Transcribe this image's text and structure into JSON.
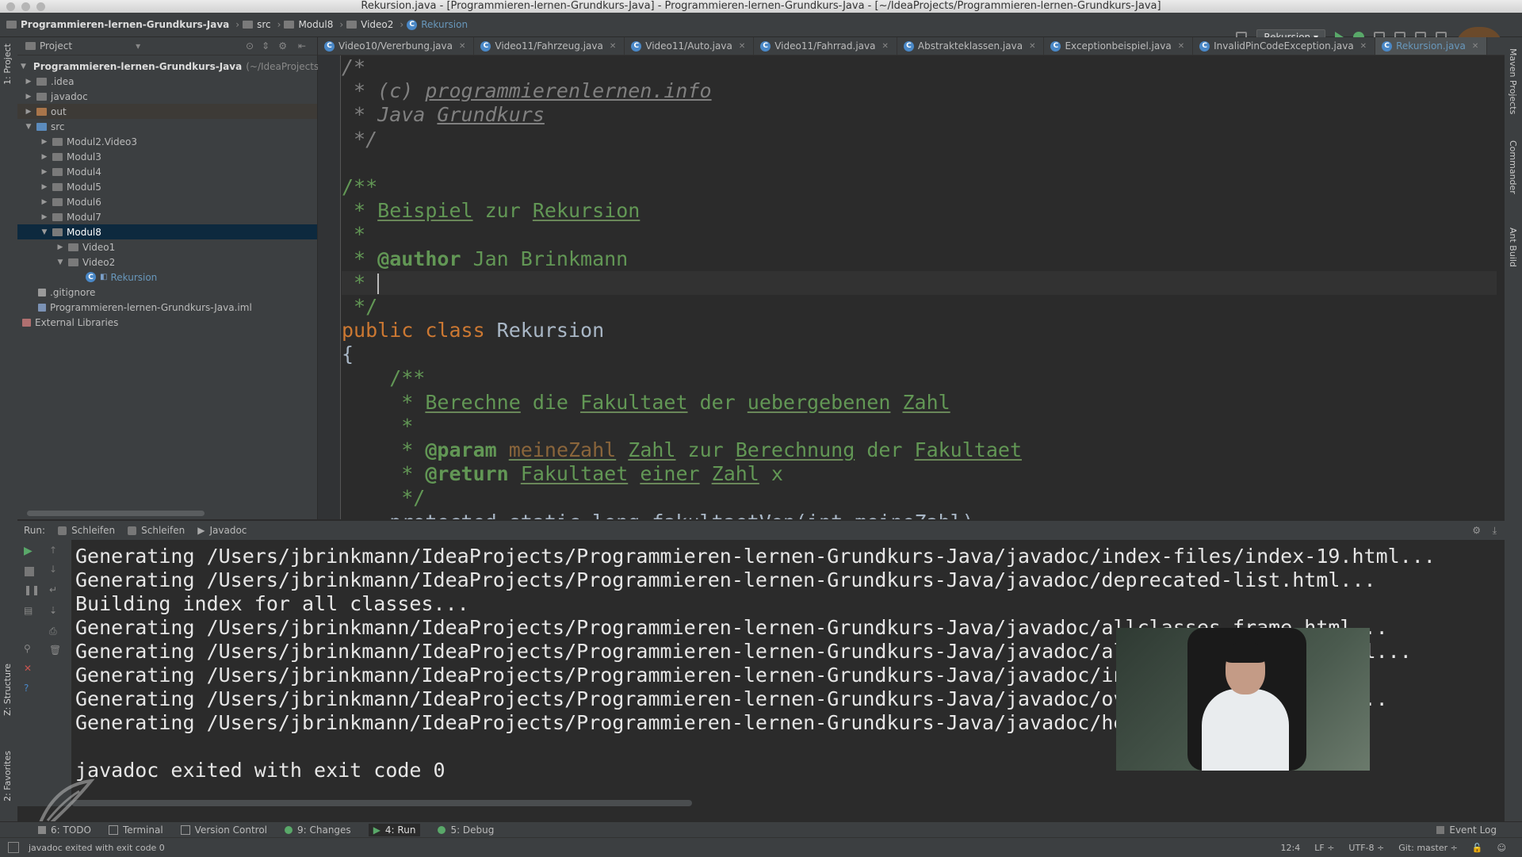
{
  "window": {
    "title": "Rekursion.java - [Programmieren-lernen-Grundkurs-Java] - Programmieren-lernen-Grundkurs-Java - [~/IdeaProjects/Programmieren-lernen-Grundkurs-Java]"
  },
  "breadcrumb": [
    "Programmieren-lernen-Grundkurs-Java",
    "src",
    "Modul8",
    "Video2",
    "Rekursion"
  ],
  "toolbar": {
    "run_config": "Rekursion"
  },
  "side_tabs_left": [
    "1: Project",
    "Z: Structure",
    "2: Favorites"
  ],
  "side_tabs_right": [
    "Maven Projects",
    "Commander",
    "Ant Build"
  ],
  "project_panel": {
    "title": "Project",
    "tree": [
      {
        "label": "Programmieren-lernen-Grundkurs-Java",
        "suffix": "(~/IdeaProjects/P"
      },
      {
        "label": ".idea"
      },
      {
        "label": "javadoc"
      },
      {
        "label": "out"
      },
      {
        "label": "src"
      },
      {
        "label": "Modul2.Video3"
      },
      {
        "label": "Modul3"
      },
      {
        "label": "Modul4"
      },
      {
        "label": "Modul5"
      },
      {
        "label": "Modul6"
      },
      {
        "label": "Modul7"
      },
      {
        "label": "Modul8"
      },
      {
        "label": "Video1"
      },
      {
        "label": "Video2"
      },
      {
        "label": "Rekursion"
      },
      {
        "label": ".gitignore"
      },
      {
        "label": "Programmieren-lernen-Grundkurs-Java.iml"
      },
      {
        "label": "External Libraries"
      }
    ]
  },
  "editor_tabs": [
    "Video10/Vererbung.java",
    "Video11/Fahrzeug.java",
    "Video11/Auto.java",
    "Video11/Fahrrad.java",
    "Abstrakteklassen.java",
    "Exceptionbeispiel.java",
    "InvalidPinCodeException.java",
    "Rekursion.java"
  ],
  "code": {
    "l1": "/*",
    "l2_pre": " * (c) ",
    "l2_link": "programmierenlernen.info",
    "l3_pre": " * Java ",
    "l3_word": "Grundkurs",
    "l4": " */",
    "l6": "/**",
    "l7_pre": " * ",
    "l7_w1": "Beispiel",
    "l7_mid": " zur ",
    "l7_w2": "Rekursion",
    "l8": " *",
    "l9_pre": " * ",
    "l9_tag": "@author",
    "l9_rest": " Jan Brinkmann",
    "l10": " * ",
    "l11": " */",
    "l12_kw": "public class",
    "l12_name": " Rekursion",
    "l13": "{",
    "l14": "    /**",
    "l15_pre": "     * ",
    "l15_w1": "Berechne",
    "l15_sp1": " die ",
    "l15_w2": "Fakultaet",
    "l15_sp2": " der ",
    "l15_w3": "uebergebenen",
    "l15_sp3": " ",
    "l15_w4": "Zahl",
    "l16": "     *",
    "l17_pre": "     * ",
    "l17_tag": "@param",
    "l17_sp0": " ",
    "l17_param": "meineZahl",
    "l17_sp1": " ",
    "l17_w1": "Zahl",
    "l17_sp2": " zur ",
    "l17_w2": "Berechnung",
    "l17_sp3": " der ",
    "l17_w3": "Fakultaet",
    "l18_pre": "     * ",
    "l18_tag": "@return",
    "l18_sp1": " ",
    "l18_w1": "Fakultaet",
    "l18_sp2": " ",
    "l18_w2": "einer",
    "l18_sp3": " ",
    "l18_w3": "Zahl",
    "l18_rest": " x",
    "l19": "     */",
    "l20": "    protected static long fakultaetVon(int meineZahl)"
  },
  "run_panel": {
    "label": "Run:",
    "tabs": [
      "Schleifen",
      "Schleifen",
      "Javadoc"
    ],
    "lines": [
      "Generating /Users/jbrinkmann/IdeaProjects/Programmieren-lernen-Grundkurs-Java/javadoc/index-files/index-19.html...",
      "Generating /Users/jbrinkmann/IdeaProjects/Programmieren-lernen-Grundkurs-Java/javadoc/deprecated-list.html...",
      "Building index for all classes...",
      "Generating /Users/jbrinkmann/IdeaProjects/Programmieren-lernen-Grundkurs-Java/javadoc/allclasses-frame.html...",
      "Generating /Users/jbrinkmann/IdeaProjects/Programmieren-lernen-Grundkurs-Java/javadoc/allclasses-noframe.html...",
      "Generating /Users/jbrinkmann/IdeaProjects/Programmieren-lernen-Grundkurs-Java/javadoc/index.html...",
      "Generating /Users/jbrinkmann/IdeaProjects/Programmieren-lernen-Grundkurs-Java/javadoc/overview-summary.html...",
      "Generating /Users/jbrinkmann/IdeaProjects/Programmieren-lernen-Grundkurs-Java/javadoc/help-doc.html...",
      "",
      "javadoc exited with exit code 0"
    ]
  },
  "bottom_tools": [
    "6: TODO",
    "Terminal",
    "Version Control",
    "9: Changes",
    "4: Run",
    "5: Debug"
  ],
  "event_log": "Event Log",
  "status": {
    "message": "javadoc exited with exit code 0",
    "position": "12:4",
    "line_sep": "LF",
    "encoding": "UTF-8",
    "vcs": "Git: master"
  }
}
